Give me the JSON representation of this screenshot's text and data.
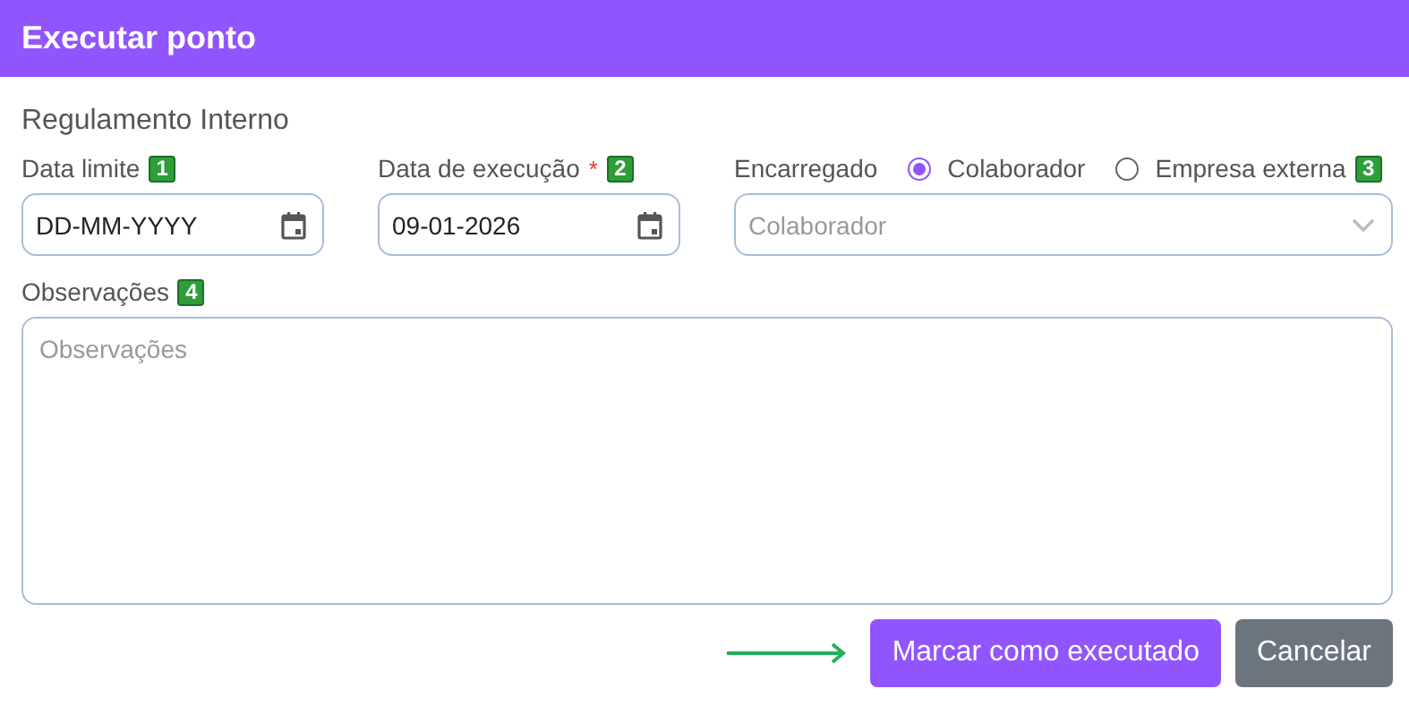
{
  "dialog": {
    "title": "Executar ponto"
  },
  "section_title": "Regulamento Interno",
  "fields": [
    {
      "label": "Data limite",
      "badge": "1",
      "placeholder": "DD-MM-YYYY"
    },
    {
      "label": "Data de execução",
      "required_mark": "*",
      "badge": "2",
      "value": "09-01-2026"
    }
  ],
  "assignee": {
    "label": "Encarregado",
    "badge": "3",
    "options": [
      {
        "label": "Colaborador",
        "selected": true
      },
      {
        "label": "Empresa externa",
        "selected": false
      }
    ],
    "select_placeholder": "Colaborador"
  },
  "notes": {
    "label": "Observações",
    "badge": "4",
    "placeholder": "Observações"
  },
  "buttons": [
    {
      "label": "Marcar como executado",
      "kind": "primary"
    },
    {
      "label": "Cancelar",
      "kind": "secondary"
    }
  ]
}
